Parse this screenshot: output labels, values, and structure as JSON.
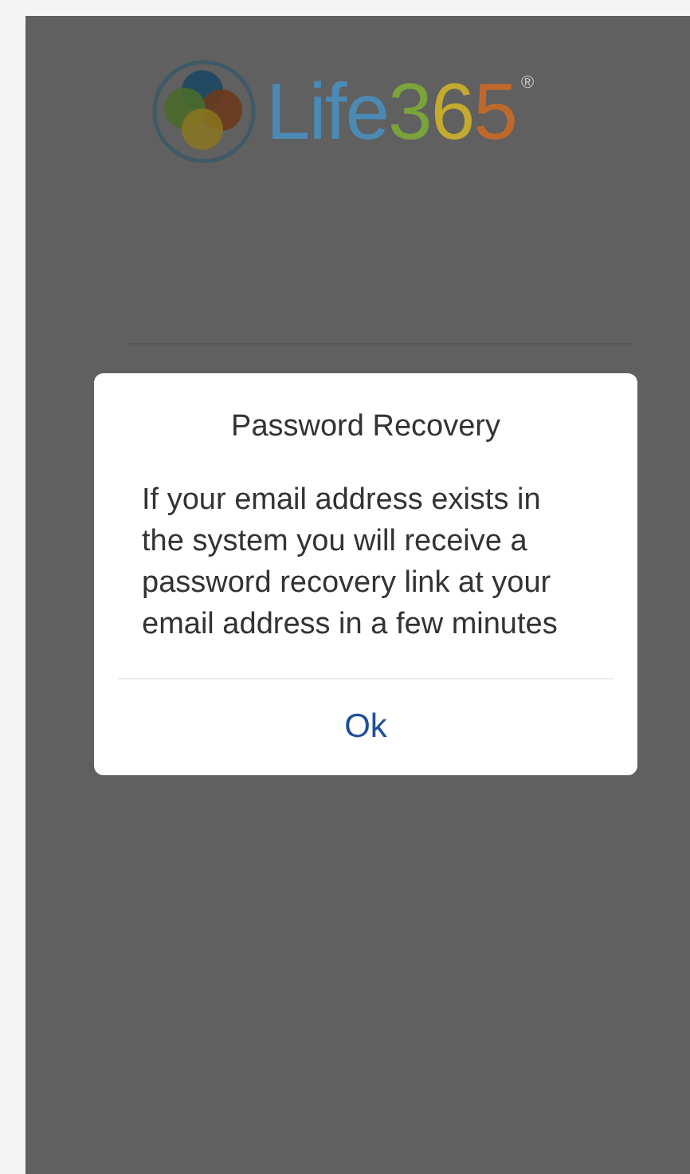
{
  "logo": {
    "word": "Life",
    "number": "365",
    "mark": "®"
  },
  "dialog": {
    "title": "Password Recovery",
    "message": "If your email address exists in the system you will receive a password recovery link at your email address in a few minutes",
    "button": "Ok"
  }
}
